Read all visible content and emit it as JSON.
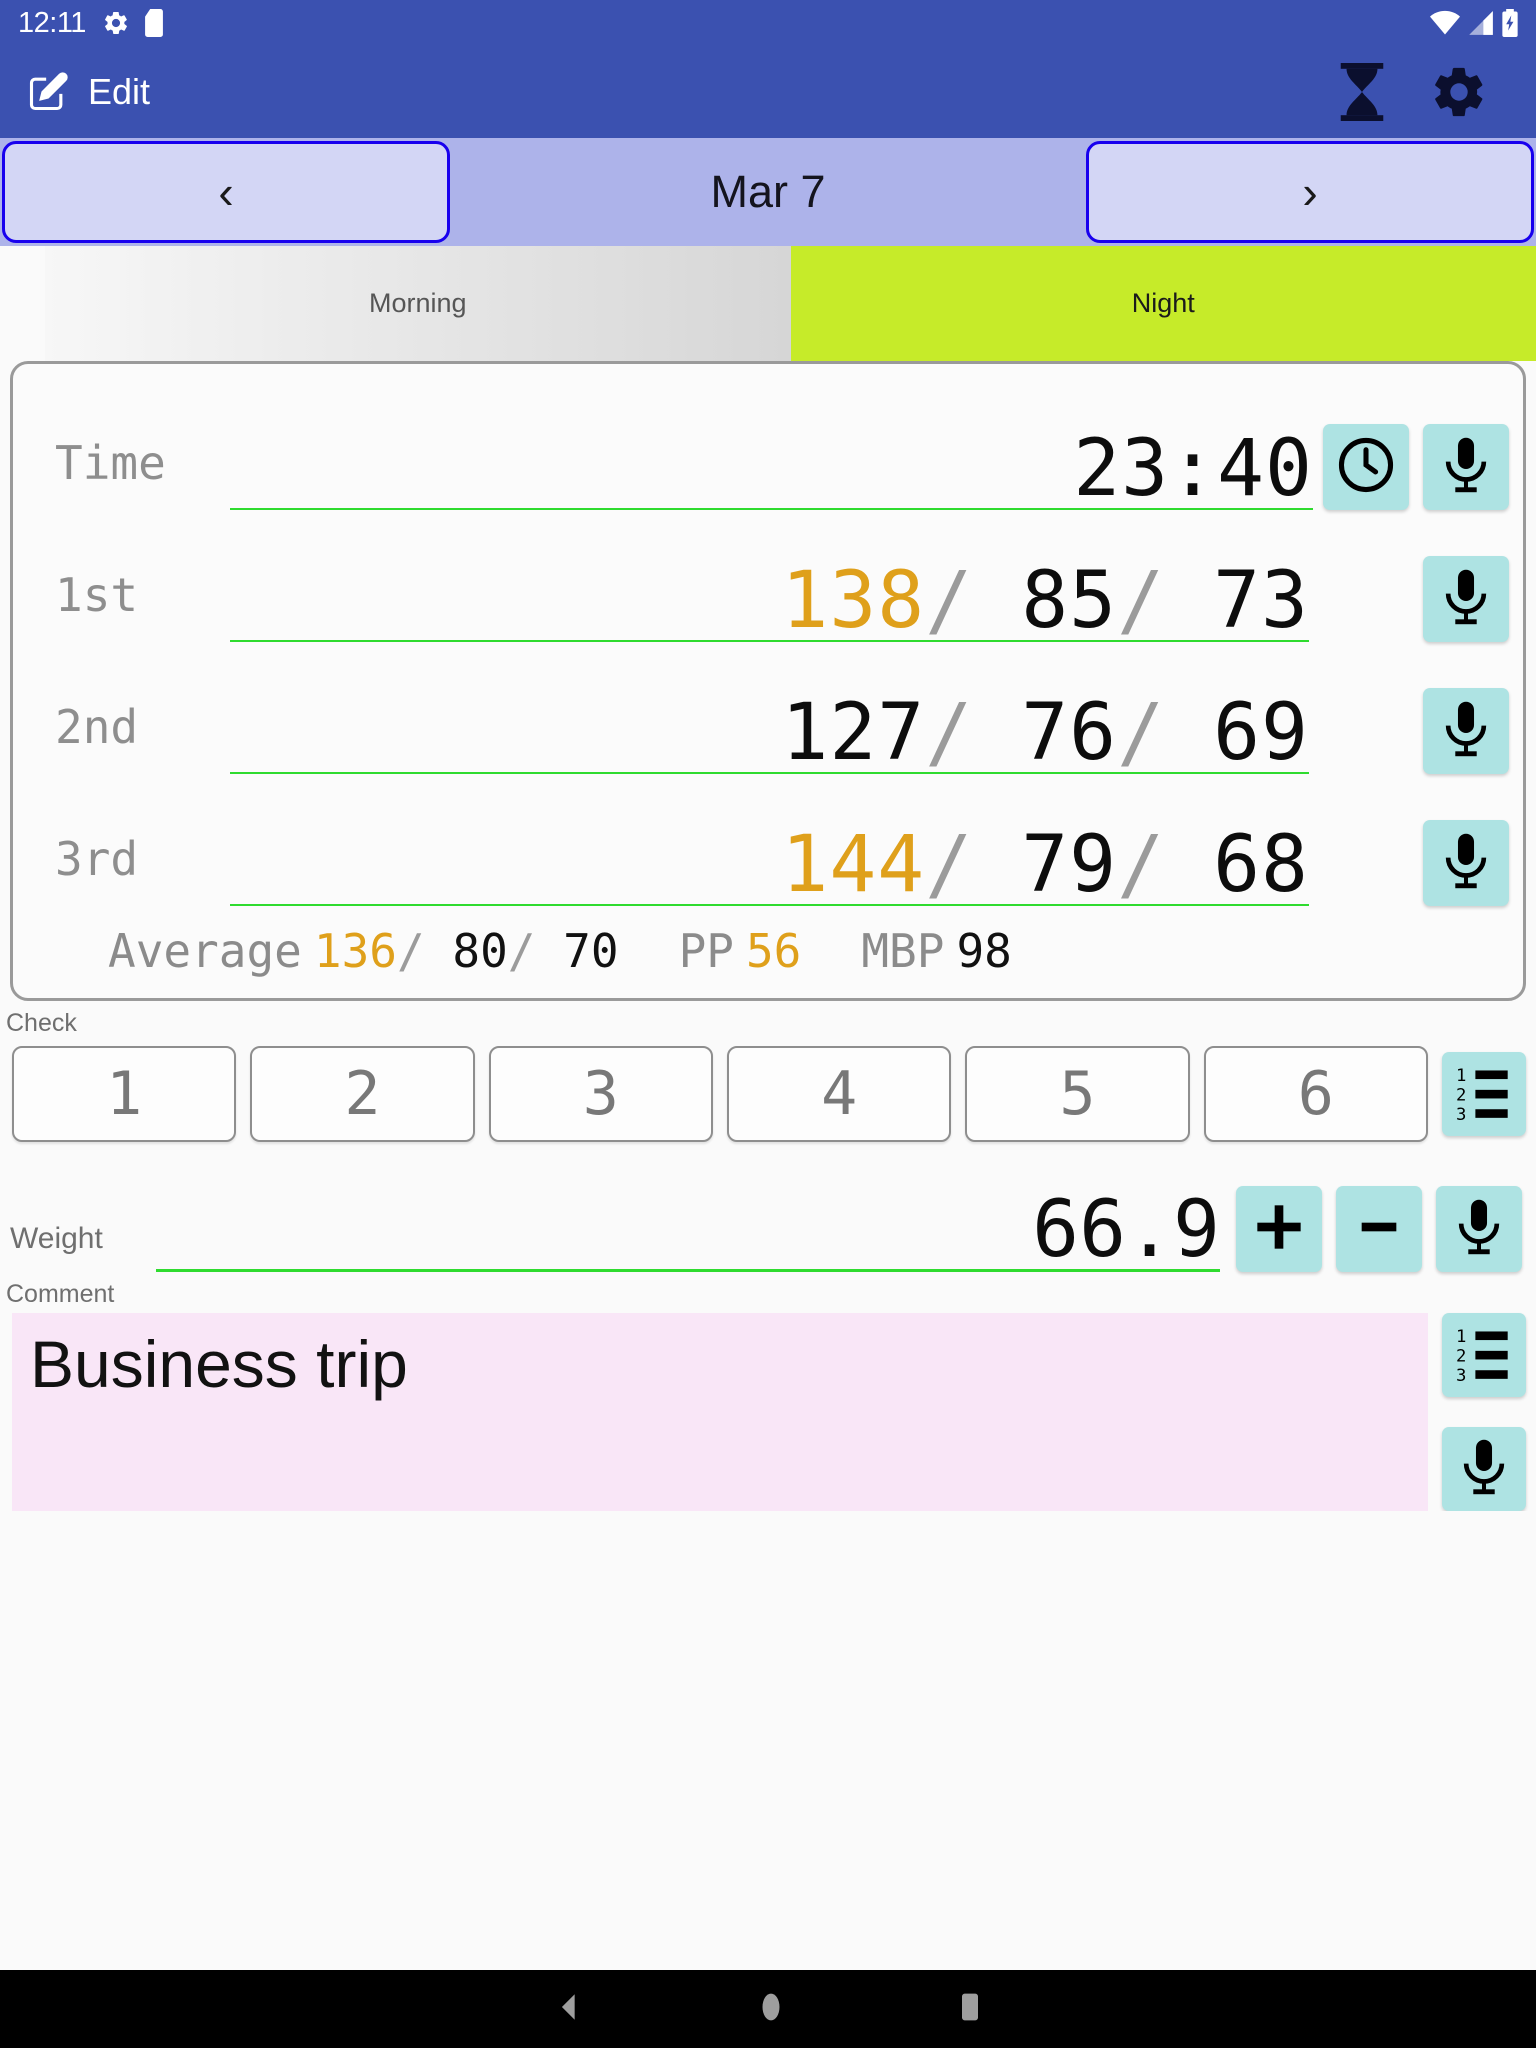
{
  "status_bar": {
    "time": "12:11",
    "icons": [
      "gear-icon",
      "sd-card-icon",
      "wifi-icon",
      "signal-icon",
      "battery-charging-icon"
    ]
  },
  "app_bar": {
    "edit_label": "Edit",
    "edit_icon": "edit-pencil-icon",
    "actions": [
      {
        "name": "hourglass-icon",
        "label": "Timer"
      },
      {
        "name": "gear-icon",
        "label": "Settings"
      }
    ]
  },
  "date_nav": {
    "prev_label": "‹",
    "next_label": "›",
    "current_date": "Mar 7"
  },
  "tabs": [
    {
      "id": "morning",
      "label": "Morning",
      "selected": false
    },
    {
      "id": "night",
      "label": "Night",
      "selected": true
    }
  ],
  "measurements": {
    "time_row": {
      "label": "Time",
      "value": "23:40",
      "clock_button": "clock-icon",
      "mic_button": "microphone-icon"
    },
    "rows": [
      {
        "label": "1st",
        "systolic": "138",
        "diastolic": "85",
        "pulse": "73",
        "systolic_alert": true,
        "mic_button": "microphone-icon"
      },
      {
        "label": "2nd",
        "systolic": "127",
        "diastolic": "76",
        "pulse": "69",
        "systolic_alert": false,
        "mic_button": "microphone-icon"
      },
      {
        "label": "3rd",
        "systolic": "144",
        "diastolic": "79",
        "pulse": "68",
        "systolic_alert": true,
        "mic_button": "microphone-icon"
      }
    ],
    "average": {
      "label": "Average",
      "systolic": "136",
      "diastolic": "80",
      "pulse": "70",
      "systolic_alert": true,
      "pp_label": "PP",
      "pp_value": "56",
      "pp_alert": true,
      "mbp_label": "MBP",
      "mbp_value": "98"
    },
    "separator": "/"
  },
  "check": {
    "label": "Check",
    "buttons": [
      "1",
      "2",
      "3",
      "4",
      "5",
      "6"
    ],
    "list_button": "numbered-list-icon"
  },
  "weight": {
    "label": "Weight",
    "value": "66.9",
    "plus_label": "+",
    "minus_label": "−",
    "mic_button": "microphone-icon"
  },
  "comment": {
    "label": "Comment",
    "value": "Business trip",
    "placeholder": "",
    "list_button": "numbered-list-icon",
    "mic_button": "microphone-icon"
  },
  "nav_bar": {
    "back": "back-triangle-icon",
    "home": "home-circle-icon",
    "recents": "recents-square-icon"
  },
  "colors": {
    "primary": "#3b51b0",
    "date_nav_bg": "#adb3ea",
    "nav_button_bg": "#d3d6f5",
    "nav_button_border": "#1800ee",
    "night_tab": "#c6eb29",
    "icon_button": "#aee3e3",
    "underline_green": "#2fdb2f",
    "alert_orange": "#dfa01b",
    "comment_bg": "#f9e6f7"
  }
}
